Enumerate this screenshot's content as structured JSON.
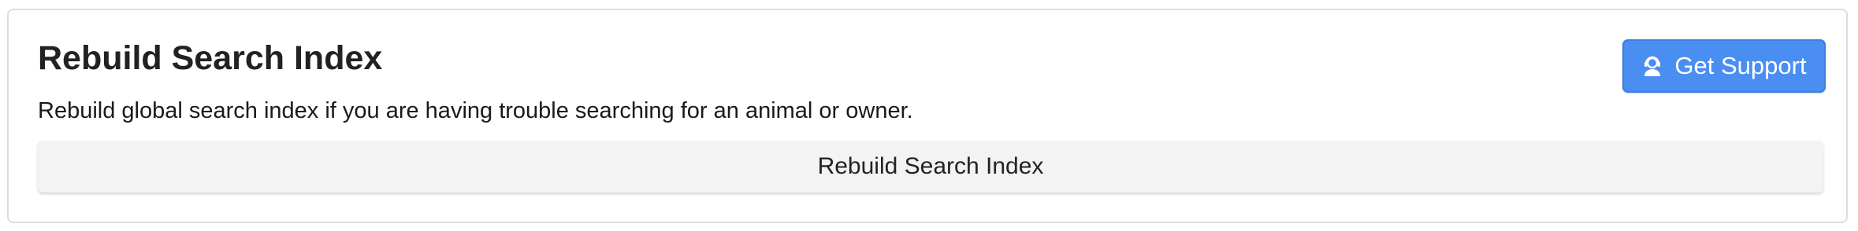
{
  "panel": {
    "title": "Rebuild Search Index",
    "description": "Rebuild global search index if you are having trouble searching for an animal or owner.",
    "rebuild_button_label": "Rebuild Search Index"
  },
  "support": {
    "label": "Get Support",
    "icon": "headset-agent-icon"
  },
  "colors": {
    "accent": "#4a8ef2",
    "card_border": "#dddddd",
    "secondary_button_bg": "#f3f3f3"
  }
}
